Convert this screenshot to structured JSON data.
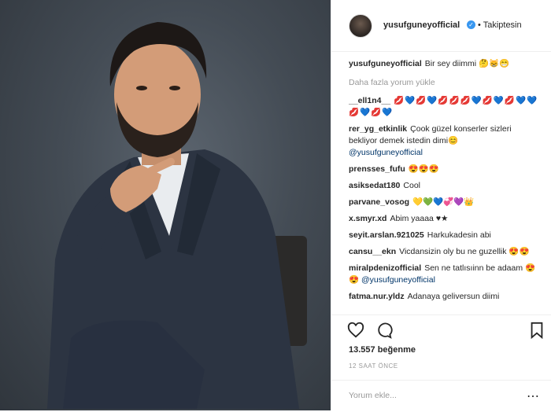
{
  "header": {
    "username": "yusufguneyofficial",
    "verified_icon": "✓",
    "follow_label": "• Takiptesin"
  },
  "caption": {
    "username": "yusufguneyofficial",
    "text": "Bir sey diimmi 🤔😸😁"
  },
  "load_more": "Daha fazla yorum yükle",
  "comments": [
    {
      "username": "__ell1n4__",
      "text": "💋💙💋💙💋💋💋💙💋💙💋💙💙💋💙💋💙"
    },
    {
      "username": "rer_yg_etkinlik",
      "text": "Çook güzel konserler sizleri bekliyor demek istedin dimi😊",
      "mention": "@yusufguneyofficial"
    },
    {
      "username": "prensses_fufu",
      "text": "😍😍😍"
    },
    {
      "username": "asiksedat180",
      "text": "Cool"
    },
    {
      "username": "parvane_vosog",
      "text": "💛💚💙💞💜👑"
    },
    {
      "username": "x.smyr.xd",
      "text": "Abim yaaaa ♥★"
    },
    {
      "username": "seyit.arslan.921025",
      "text": "Harkukadesin abi"
    },
    {
      "username": "cansu__ekn",
      "text": "Vicdansizin oly bu ne guzellik 😍😍"
    },
    {
      "username": "miralpdenizofficial",
      "text": "Sen ne tatlısıinn be adaam 😍😍",
      "mention": "@yusufguneyofficial"
    },
    {
      "username": "fatma.nur.yldz",
      "text": "Adanaya geliversun diimi"
    }
  ],
  "actions": {
    "likes": "13.557 beğenme",
    "time": "12 SAAT ÖNCE"
  },
  "add_comment": {
    "placeholder": "Yorum ekle...",
    "menu_icon": "⋯"
  }
}
